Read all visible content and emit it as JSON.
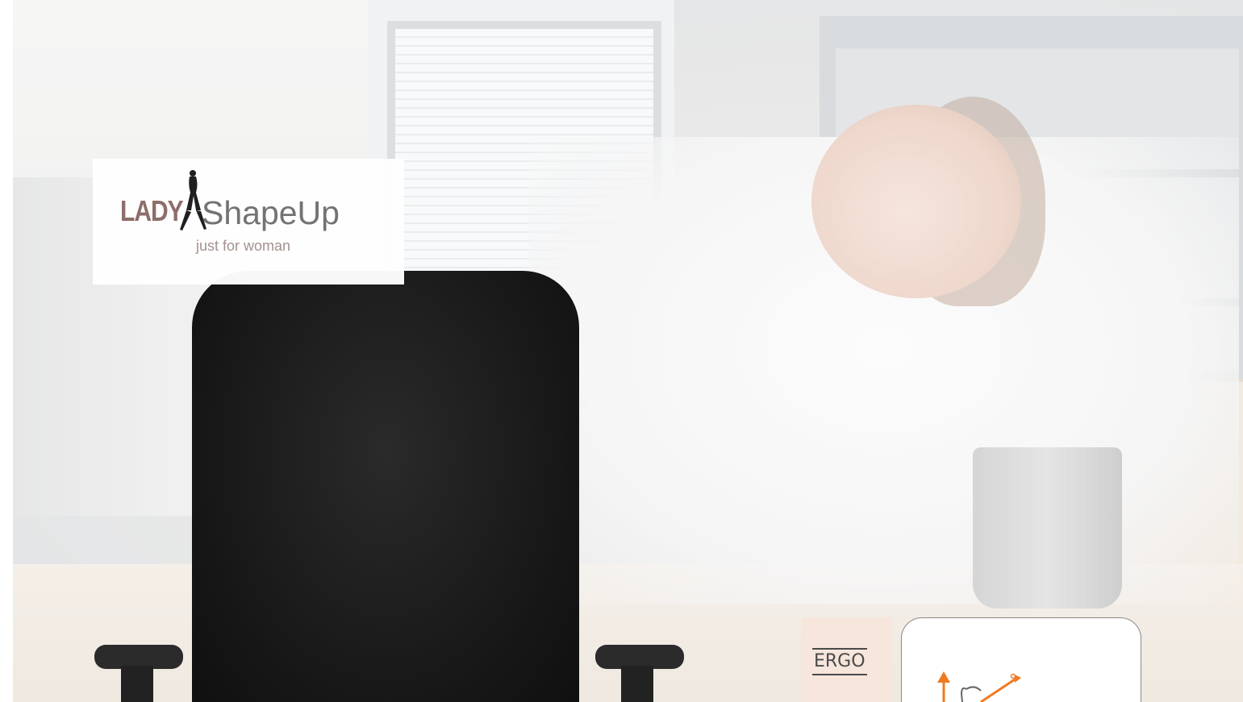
{
  "logo": {
    "brand_part1": "LADY",
    "brand_part2": "ShapeUp",
    "tagline": "just for woman"
  },
  "ergo": {
    "tab_label": "ERGO",
    "icon": "ergonomics-adjust-icon",
    "accent_color": "#f07a22"
  },
  "hero": {
    "image": "office-woman-relaxing-chair-photo"
  }
}
